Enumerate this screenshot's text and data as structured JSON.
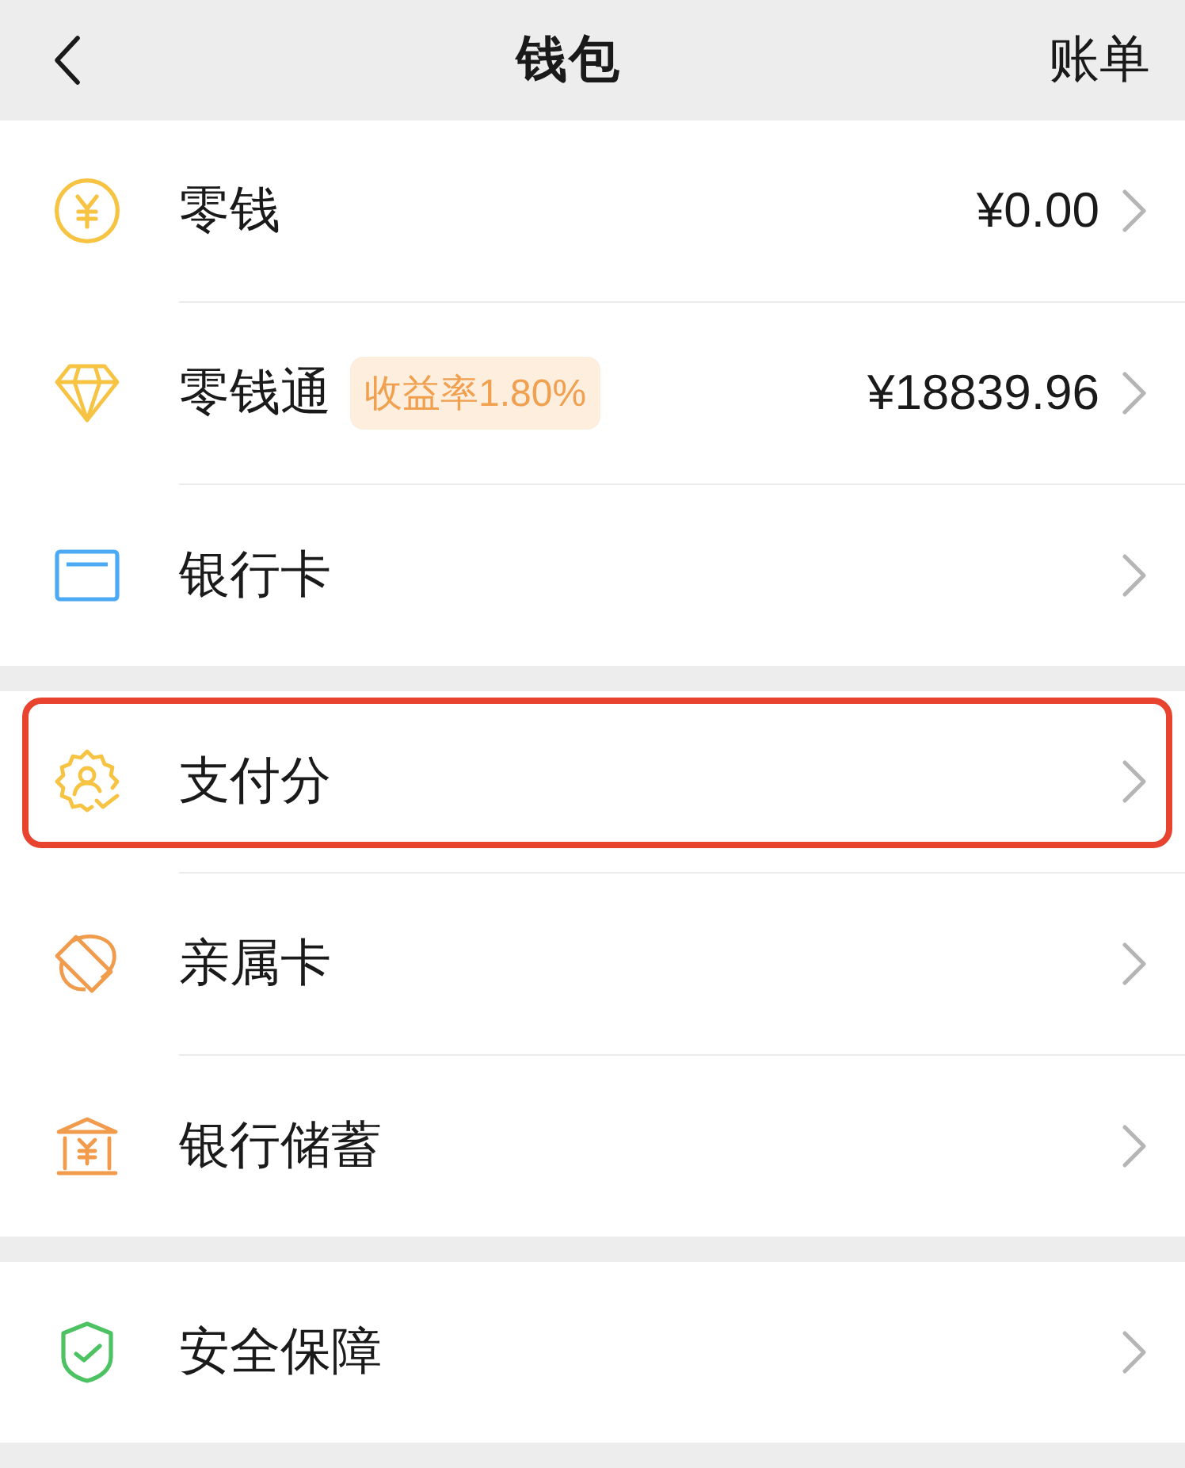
{
  "header": {
    "title": "钱包",
    "action": "账单"
  },
  "groups": [
    {
      "rows": [
        {
          "label": "零钱",
          "value": "¥0.00",
          "highlighted": false
        },
        {
          "label": "零钱通",
          "badge": "收益率1.80%",
          "value": "¥18839.96",
          "highlighted": false
        },
        {
          "label": "银行卡",
          "highlighted": false
        }
      ]
    },
    {
      "rows": [
        {
          "label": "支付分",
          "highlighted": true
        },
        {
          "label": "亲属卡",
          "highlighted": false
        },
        {
          "label": "银行储蓄",
          "highlighted": false
        }
      ]
    },
    {
      "rows": [
        {
          "label": "安全保障",
          "highlighted": false
        }
      ]
    }
  ]
}
